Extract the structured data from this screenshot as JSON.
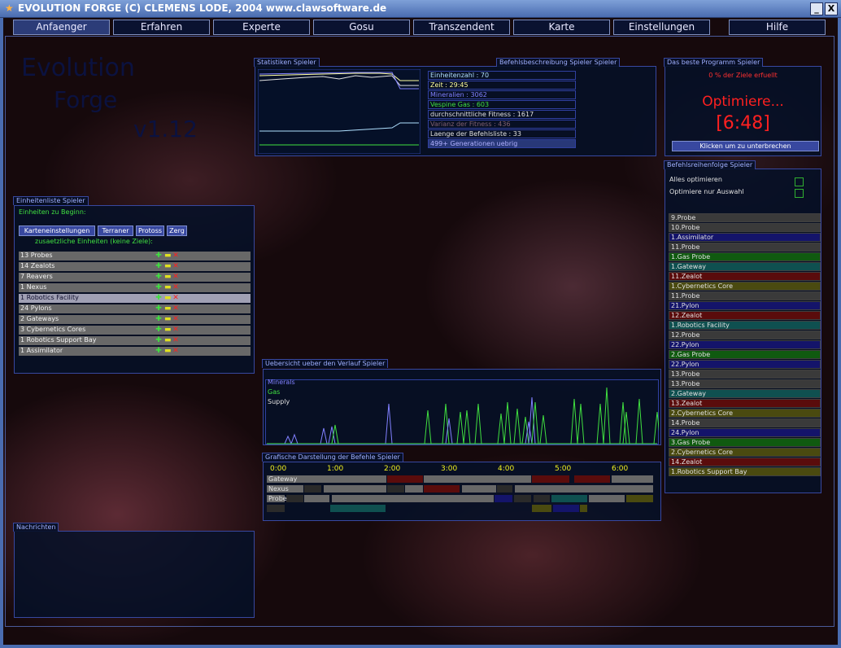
{
  "window": {
    "title": "EVOLUTION FORGE (C) CLEMENS LODE, 2004 www.clawsoftware.de",
    "min_glyph": "_",
    "close_glyph": "X",
    "star_glyph": "★"
  },
  "tabs": [
    "Anfaenger",
    "Erfahren",
    "Experte",
    "Gosu",
    "Transzendent",
    "Karte",
    "Einstellungen",
    "Hilfe"
  ],
  "logo": {
    "line1": "Evolution",
    "line2": "Forge",
    "version": "v1.12"
  },
  "stats": {
    "title": "Statistiken Spieler",
    "desc_title": "Befehlsbeschreibung Spieler Spieler",
    "lines": [
      {
        "text": "Einheitenzahl : 70",
        "color": "#b0e0ff"
      },
      {
        "text": "Zeit : 29:45",
        "color": "#ffffa0"
      },
      {
        "text": "Mineralien : 3062",
        "color": "#8080ff"
      },
      {
        "text": "Vespine Gas : 603",
        "color": "#40e040"
      },
      {
        "text": "durchschnittliche Fitness : 1617",
        "color": "#e0e0e0"
      },
      {
        "text": "Varianz der Fitness : 436",
        "color": "#806070"
      },
      {
        "text": "Laenge der Befehlsliste : 33",
        "color": "#e0e0e0"
      },
      {
        "text": "499+ Generationen uebrig",
        "color": "#b0b0ff"
      }
    ]
  },
  "best": {
    "title": "Das beste Programm Spieler",
    "goals": "0 % der Ziele erfuellt",
    "optimizing": "Optimiere...",
    "timer": "[6:48]",
    "stop_button": "Klicken um zu unterbrechen"
  },
  "order": {
    "title": "Befehlsreihenfolge Spieler",
    "opt_all": "Alles optimieren",
    "opt_sel": "Optimiere nur Auswahl",
    "items": [
      {
        "label": "9.Probe",
        "color": "#3a3a3a"
      },
      {
        "label": "10.Probe",
        "color": "#3a3a3a"
      },
      {
        "label": "1.Assimilator",
        "color": "#14146a"
      },
      {
        "label": "11.Probe",
        "color": "#3a3a3a"
      },
      {
        "label": "1.Gas Probe",
        "color": "#105a10"
      },
      {
        "label": "1.Gateway",
        "color": "#0f5050"
      },
      {
        "label": "11.Zealot",
        "color": "#5a0c0c"
      },
      {
        "label": "1.Cybernetics Core",
        "color": "#4a4a10"
      },
      {
        "label": "11.Probe",
        "color": "#3a3a3a"
      },
      {
        "label": "21.Pylon",
        "color": "#14146a"
      },
      {
        "label": "12.Zealot",
        "color": "#5a0c0c"
      },
      {
        "label": "1.Robotics Facility",
        "color": "#0f5050"
      },
      {
        "label": "12.Probe",
        "color": "#3a3a3a"
      },
      {
        "label": "22.Pylon",
        "color": "#14146a"
      },
      {
        "label": "2.Gas Probe",
        "color": "#105a10"
      },
      {
        "label": "22.Pylon",
        "color": "#14146a"
      },
      {
        "label": "13.Probe",
        "color": "#3a3a3a"
      },
      {
        "label": "13.Probe",
        "color": "#3a3a3a"
      },
      {
        "label": "2.Gateway",
        "color": "#0f5050"
      },
      {
        "label": "13.Zealot",
        "color": "#5a0c0c"
      },
      {
        "label": "2.Cybernetics Core",
        "color": "#4a4a10"
      },
      {
        "label": "14.Probe",
        "color": "#3a3a3a"
      },
      {
        "label": "24.Pylon",
        "color": "#14146a"
      },
      {
        "label": "3.Gas Probe",
        "color": "#105a10"
      },
      {
        "label": "2.Cybernetics Core",
        "color": "#4a4a10"
      },
      {
        "label": "14.Zealot",
        "color": "#5a0c0c"
      },
      {
        "label": "1.Robotics Support Bay",
        "color": "#4a4a10"
      }
    ]
  },
  "units": {
    "title": "Einheitenliste Spieler",
    "start": "Einheiten zu Beginn:",
    "buttons": [
      "Karteneinstellungen",
      "Terraner",
      "Protoss",
      "Zerg"
    ],
    "extra": "zusaetzliche Einheiten (keine Ziele):",
    "items": [
      "13 Probes",
      "14 Zealots",
      "7 Reavers",
      "1 Nexus",
      "1 Robotics Facility",
      "24 Pylons",
      "2 Gateways",
      "3 Cybernetics Cores",
      "1 Robotics Support Bay",
      "1 Assimilator"
    ],
    "selected": 4
  },
  "overview": {
    "title": "Uebersicht ueber den Verlauf Spieler",
    "legend": [
      {
        "name": "Minerals",
        "color": "#8080ff"
      },
      {
        "name": "Gas",
        "color": "#40e040"
      },
      {
        "name": "Supply",
        "color": "#e0e0e0"
      }
    ]
  },
  "graphic": {
    "title": "Grafische Darstellung der Befehle Spieler",
    "times": [
      "0:00",
      "1:00",
      "2:00",
      "3:00",
      "4:00",
      "5:00",
      "6:00"
    ],
    "rows": [
      "Gateway",
      "Nexus",
      "Probe"
    ]
  },
  "messages": {
    "title": "Nachrichten"
  },
  "colors": {
    "accent": "#3848a0",
    "mineral": "#8080ff",
    "gas": "#40e040",
    "red": "#ff2020"
  }
}
